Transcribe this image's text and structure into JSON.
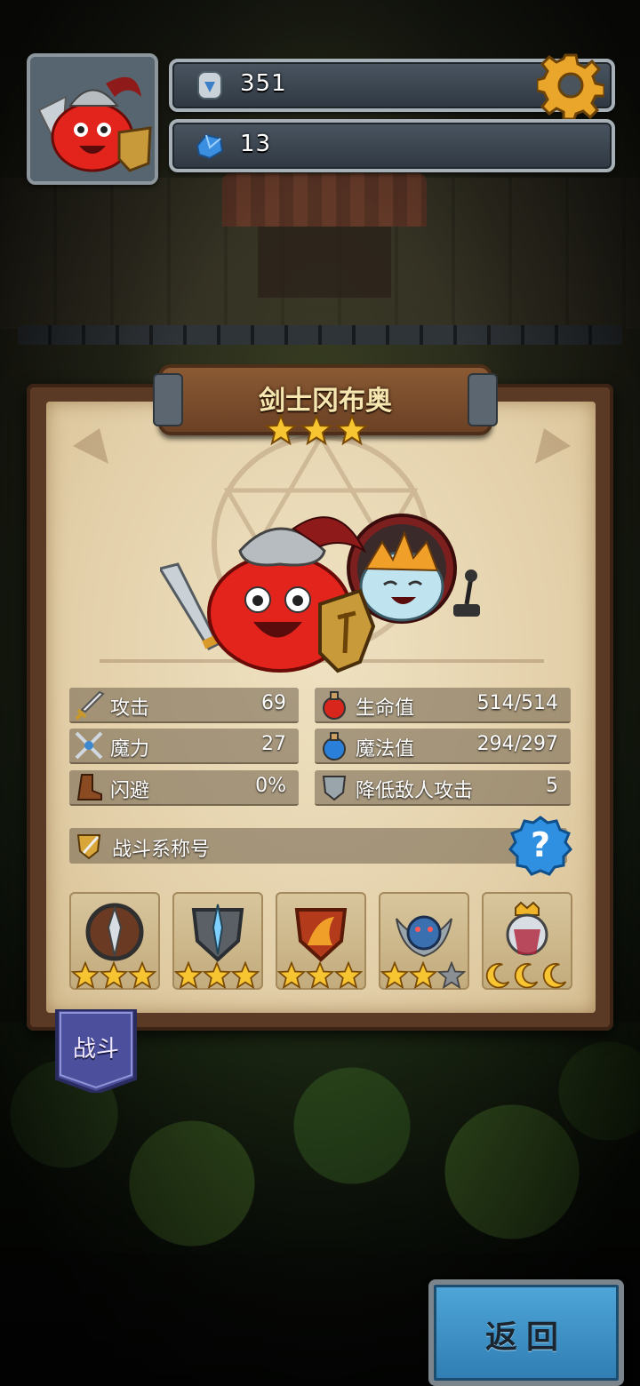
{
  "hud": {
    "currency_1": {
      "icon": "rune-stone-icon",
      "value": "351"
    },
    "currency_2": {
      "icon": "blue-gem-icon",
      "value": "13"
    },
    "settings_icon": "gear-icon"
  },
  "hero": {
    "name": "剑士冈布奥",
    "stars": 3
  },
  "stats": [
    {
      "icon": "sword-icon",
      "label": "攻击",
      "value": "69"
    },
    {
      "icon": "red-potion-icon",
      "label": "生命值",
      "value": "514/514"
    },
    {
      "icon": "crossed-weapons-icon",
      "label": "魔力",
      "value": "27"
    },
    {
      "icon": "blue-potion-icon",
      "label": "魔法值",
      "value": "294/297"
    },
    {
      "icon": "boot-icon",
      "label": "闪避",
      "value": "0%"
    },
    {
      "icon": "shield-icon",
      "label": "降低敌人攻击",
      "value": "5"
    }
  ],
  "combat_title": {
    "label": "战斗系称号",
    "help_icon": "question-mark-icon"
  },
  "badges": [
    {
      "icon": "round-shield-dagger-icon",
      "stars": 3,
      "star_type": "star"
    },
    {
      "icon": "iron-shield-sword-icon",
      "stars": 3,
      "star_type": "star"
    },
    {
      "icon": "fire-shield-icon",
      "stars": 3,
      "star_type": "star"
    },
    {
      "icon": "winged-beast-crest-icon",
      "stars": 2,
      "star_type": "star"
    },
    {
      "icon": "crowned-king-crest-icon",
      "stars": 3,
      "star_type": "moon"
    }
  ],
  "tab": {
    "label": "战斗"
  },
  "back_button": {
    "label": "返回"
  },
  "colors": {
    "gold": "#f7c531",
    "parchment": "#e4d1ab",
    "back_blue": "#3f93c9"
  }
}
